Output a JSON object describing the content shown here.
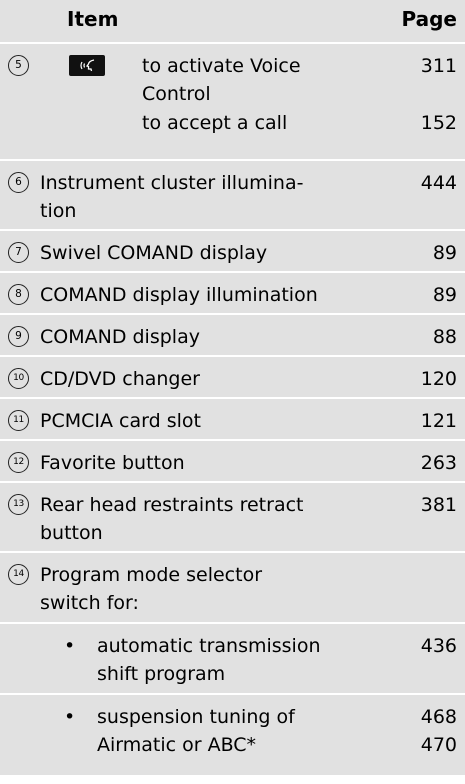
{
  "header": {
    "item": "Item",
    "page": "Page"
  },
  "rows": [
    {
      "num": "5",
      "text_a": "to activate Voice\nControl",
      "page_a": "311",
      "text_b": "to accept a call",
      "page_b": "152",
      "icon": "voice-control-button-icon"
    },
    {
      "num": "6",
      "text": "Instrument cluster illumina-\ntion",
      "page": "444"
    },
    {
      "num": "7",
      "text": "Swivel COMAND display",
      "page": "89"
    },
    {
      "num": "8",
      "text": "COMAND display illumination",
      "page": "89"
    },
    {
      "num": "9",
      "text": "COMAND display",
      "page": "88"
    },
    {
      "num": "10",
      "text": "CD/DVD changer",
      "page": "120"
    },
    {
      "num": "11",
      "text": "PCMCIA card slot",
      "page": "121"
    },
    {
      "num": "12",
      "text": "Favorite button",
      "page": "263"
    },
    {
      "num": "13",
      "text": "Rear head restraints retract\nbutton",
      "page": "381"
    },
    {
      "num": "14",
      "text": "Program mode selector\nswitch for:"
    }
  ],
  "bullets": [
    {
      "symbol": "•",
      "text": "automatic transmission\nshift program",
      "page": "436"
    },
    {
      "symbol": "•",
      "text": "suspension tuning of\nAirmatic or ABC*",
      "page_a": "468",
      "page_b": "470"
    }
  ]
}
